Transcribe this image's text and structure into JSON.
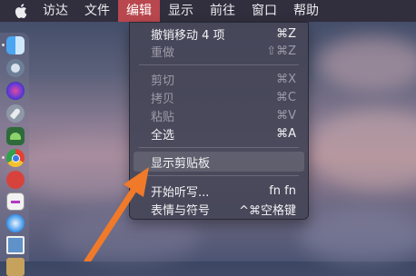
{
  "menubar": {
    "apple_icon": "apple-logo-icon",
    "items": [
      "访达",
      "文件",
      "编辑",
      "显示",
      "前往",
      "窗口",
      "帮助"
    ],
    "active_index": 2,
    "active_color": "#b9474e"
  },
  "edit_menu": {
    "items": [
      {
        "label": "撤销移动 4 项",
        "shortcut": "⌘Z",
        "enabled": true
      },
      {
        "label": "重做",
        "shortcut": "⇧⌘Z",
        "enabled": false
      },
      {
        "label": "剪切",
        "shortcut": "⌘X",
        "enabled": false
      },
      {
        "label": "拷贝",
        "shortcut": "⌘C",
        "enabled": false
      },
      {
        "label": "粘贴",
        "shortcut": "⌘V",
        "enabled": false
      },
      {
        "label": "全选",
        "shortcut": "⌘A",
        "enabled": true
      },
      {
        "label": "显示剪贴板",
        "shortcut": "",
        "enabled": true,
        "highlighted": true
      },
      {
        "label": "开始听写...",
        "shortcut": "fn fn",
        "enabled": true
      },
      {
        "label": "表情与符号",
        "shortcut": "^⌘空格键",
        "enabled": true
      }
    ]
  },
  "dock": {
    "icons": [
      "finder-icon",
      "launchpad-icon",
      "siri-icon",
      "rocket-icon",
      "android-icon",
      "chrome-icon",
      "app-store-red-icon",
      "calendar-icon",
      "safari-icon",
      "preview-icon",
      "notes-icon"
    ]
  },
  "annotation": {
    "arrow_color": "#f07a2a"
  }
}
